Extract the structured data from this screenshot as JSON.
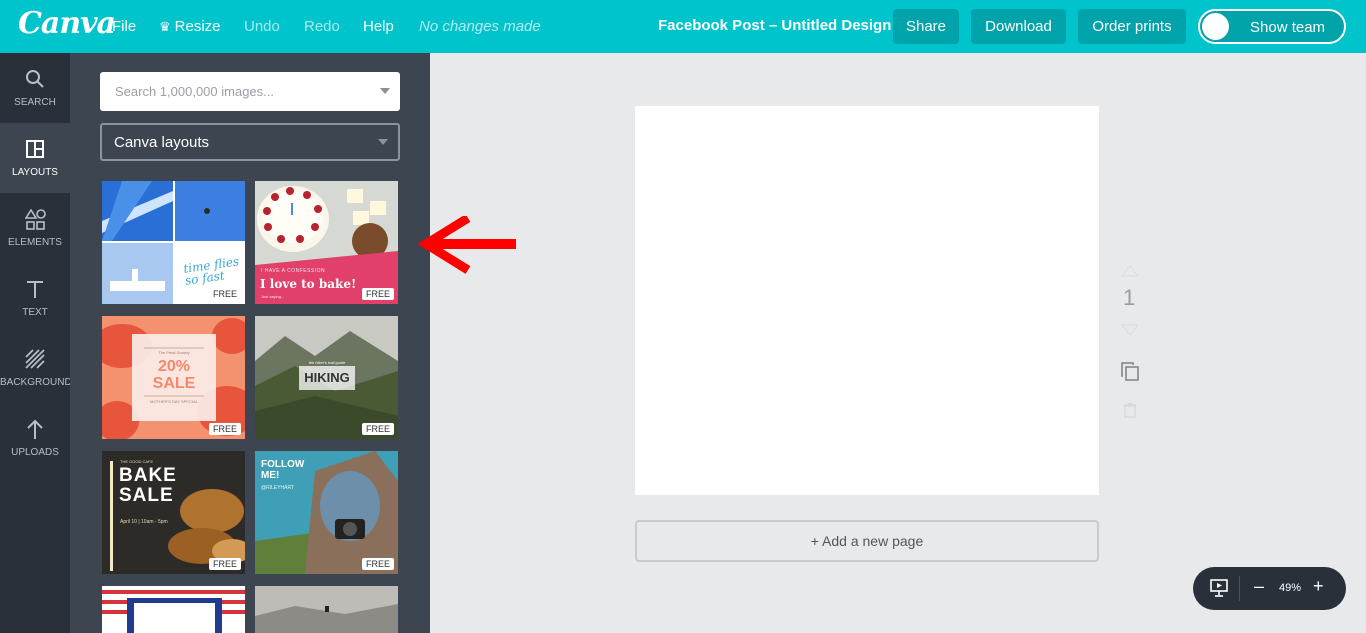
{
  "topbar": {
    "logo": "Canva",
    "menu": {
      "file": "File",
      "resize": "Resize",
      "undo": "Undo",
      "redo": "Redo",
      "help": "Help"
    },
    "status": "No changes made",
    "doc_title": "Facebook Post – Untitled Design",
    "share": "Share",
    "download": "Download",
    "order_prints": "Order prints",
    "show_team": "Show team"
  },
  "leftnav": {
    "items": [
      {
        "label": "SEARCH",
        "icon": "search-icon"
      },
      {
        "label": "LAYOUTS",
        "icon": "layouts-icon"
      },
      {
        "label": "ELEMENTS",
        "icon": "elements-icon"
      },
      {
        "label": "TEXT",
        "icon": "text-icon"
      },
      {
        "label": "BACKGROUND",
        "icon": "background-icon"
      },
      {
        "label": "UPLOADS",
        "icon": "uploads-icon"
      }
    ]
  },
  "panel": {
    "search_placeholder": "Search 1,000,000 images...",
    "select_value": "Canva layouts",
    "free_badge": "FREE",
    "layouts": [
      {
        "text_a": "time flies",
        "text_b": "so fast"
      },
      {
        "text_a": "I HAVE A CONFESSION",
        "text_b": "I love to bake!",
        "text_c": "Just saying..."
      },
      {
        "text_a": "The Petal Society",
        "text_b": "20%",
        "text_c": "SALE",
        "text_d": "MOTHER'S DAY SPECIAL"
      },
      {
        "text_a": "HIKING",
        "text_b": "the hiker's trail guide"
      },
      {
        "text_a": "THE GOOD CAFE",
        "text_b": "BAKE",
        "text_c": "SALE",
        "text_d": "April 10 | 10am - 5pm"
      },
      {
        "text_a": "FOLLOW",
        "text_b": "ME!",
        "text_c": "@RILEYHART"
      }
    ]
  },
  "canvas": {
    "page_number": "1",
    "add_page": "+ Add a new page"
  },
  "zoom": {
    "minus": "–",
    "value": "49%",
    "plus": "+"
  },
  "colors": {
    "brand": "#00c4cc",
    "nav": "#293039",
    "panel": "#3d4550",
    "arrow": "#ff0000"
  }
}
